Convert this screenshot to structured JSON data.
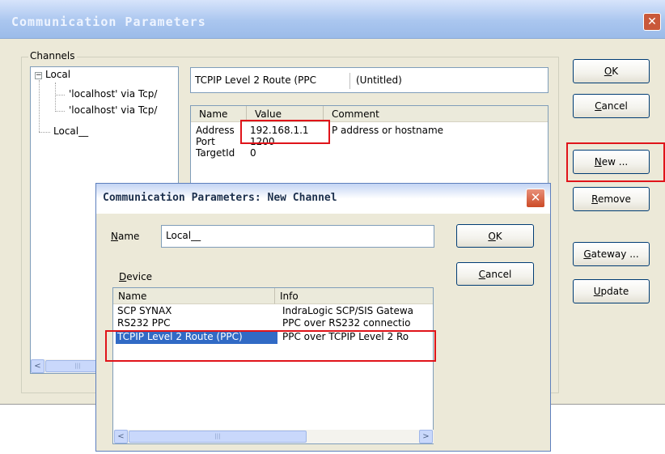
{
  "main_window": {
    "title": "Communication Parameters",
    "close_glyph": "✕",
    "channels_label": "Channels",
    "tree": {
      "root": "Local",
      "children": [
        "'localhost' via Tcp/",
        "'localhost' via Tcp/"
      ],
      "sibling": "Local__"
    },
    "device_field": {
      "device": "TCPIP  Level 2 Route (PPC",
      "name": "(Untitled)"
    },
    "params_table": {
      "columns": [
        "Name",
        "Value",
        "Comment"
      ],
      "rows": [
        {
          "name": "Address",
          "value": "192.168.1.1",
          "comment": "P address or hostname"
        },
        {
          "name": "Port",
          "value": "1200",
          "comment": ""
        },
        {
          "name": "TargetId",
          "value": "0",
          "comment": ""
        }
      ]
    },
    "buttons": {
      "ok": {
        "u": "O",
        "rest": "K"
      },
      "cancel": {
        "u": "C",
        "rest": "ancel"
      },
      "new": {
        "u": "N",
        "rest": "ew ..."
      },
      "remove": {
        "u": "R",
        "rest": "emove"
      },
      "gateway": {
        "u": "G",
        "rest": "ateway ..."
      },
      "update": {
        "u": "U",
        "rest": "pdate"
      }
    }
  },
  "dialog": {
    "title": "Communication Parameters: New Channel",
    "close_glyph": "✕",
    "name_label": {
      "u": "N",
      "rest": "ame"
    },
    "name_value": "Local__",
    "device_label": {
      "u": "D",
      "rest": "evice"
    },
    "ok": {
      "u": "O",
      "rest": "K"
    },
    "cancel": {
      "u": "C",
      "rest": "ancel"
    },
    "device_list": {
      "columns": [
        "Name",
        "Info"
      ],
      "rows": [
        {
          "name": "SCP SYNAX",
          "info": "IndraLogic SCP/SIS Gatewa"
        },
        {
          "name": "RS232 PPC",
          "info": "PPC over RS232 connectio"
        },
        {
          "name": "TCPIP  Level 2 Route (PPC)",
          "info": "PPC over TCPIP  Level 2 Ro"
        }
      ],
      "selected_index": 2
    }
  },
  "scroll": {
    "left": "<",
    "right": ">",
    "thumb": "|||"
  },
  "colors": {
    "highlight": "#e0141a",
    "selection": "#316ac5"
  }
}
